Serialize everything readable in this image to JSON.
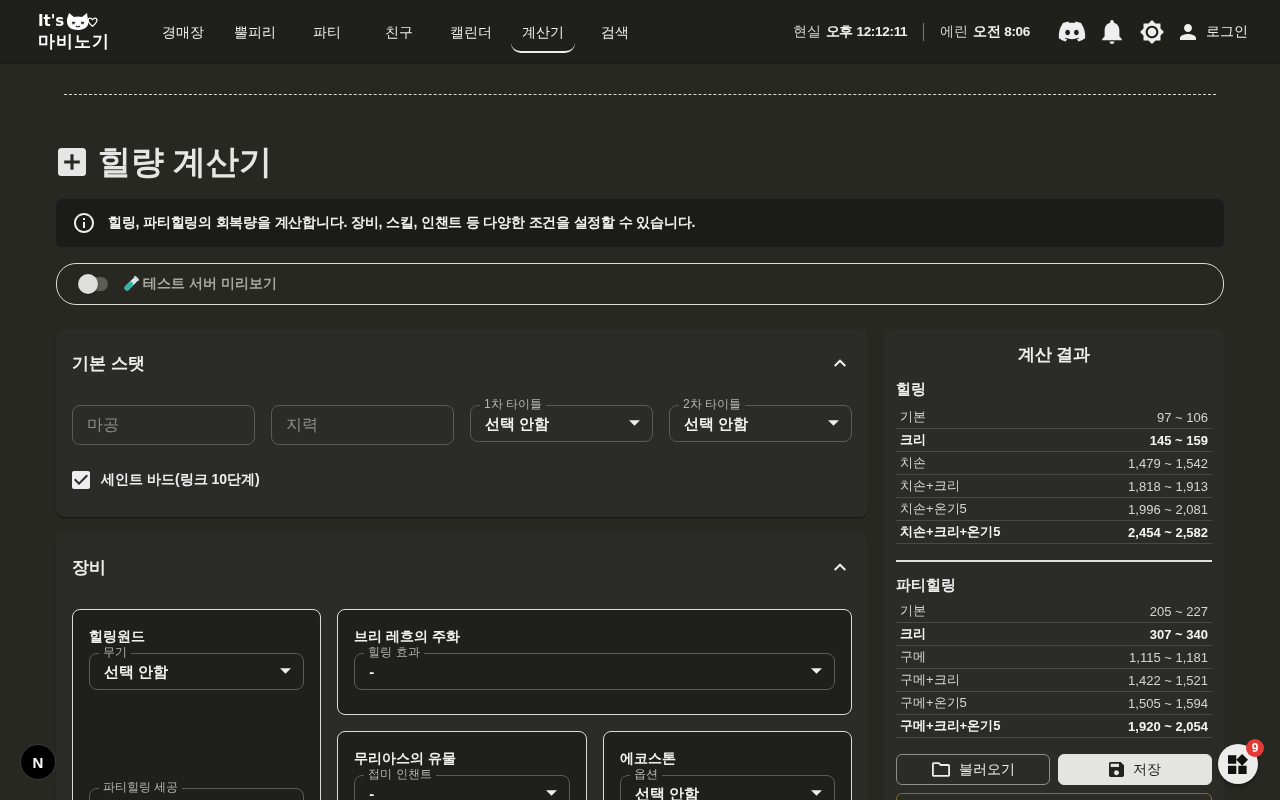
{
  "header": {
    "logo": {
      "line1": "It's",
      "line2": "마비노기"
    },
    "nav": [
      {
        "label": "경매장",
        "selected": false
      },
      {
        "label": "뿔피리",
        "selected": false
      },
      {
        "label": "파티",
        "selected": false
      },
      {
        "label": "친구",
        "selected": false
      },
      {
        "label": "캘린더",
        "selected": false
      },
      {
        "label": "계산기",
        "selected": true
      },
      {
        "label": "검색",
        "selected": false
      }
    ],
    "clocks": [
      {
        "label": "현실",
        "value": "오후 12:12:11"
      },
      {
        "label": "에린",
        "value": "오전 8:06"
      }
    ],
    "login": "로그인"
  },
  "page": {
    "title": "힐량 계산기",
    "notice": "힐링, 파티힐링의 회복량을 계산합니다. 장비, 스킬, 인챈트 등 다양한 조건을 설정할 수 있습니다.",
    "test_server": {
      "label": "테스트 서버 미리보기",
      "on": false
    }
  },
  "sections": [
    {
      "title": "기본 스탯",
      "expanded": true,
      "fields": [
        {
          "kind": "input",
          "placeholder": "마공"
        },
        {
          "kind": "input",
          "placeholder": "지력"
        },
        {
          "kind": "select",
          "label": "1차 타이틀",
          "value": "선택 안함"
        },
        {
          "kind": "select",
          "label": "2차 타이틀",
          "value": "선택 안함"
        }
      ],
      "checkboxes": [
        {
          "label": "세인트 바드(링크 10단계)",
          "checked": true
        }
      ]
    },
    {
      "title": "장비",
      "expanded": true,
      "cards": [
        {
          "title": "힐링원드",
          "fields": [
            {
              "label": "무기",
              "value": "선택 안함"
            },
            {
              "label": "파티힐링 세공"
            }
          ]
        },
        {
          "title": "브리 레흐의 주화",
          "fields": [
            {
              "label": "힐링 효과",
              "value": "-"
            }
          ]
        },
        {
          "title": "무리아스의 유물",
          "fields": [
            {
              "label": "접미 인챈트",
              "value": "-"
            }
          ]
        },
        {
          "title": "에코스톤",
          "fields": [
            {
              "label": "옵션",
              "value": "선택 안함"
            }
          ]
        }
      ]
    }
  ],
  "results": {
    "title": "계산 결과",
    "groups": [
      {
        "name": "힐링",
        "rows": [
          {
            "label": "기본",
            "value": "97 ~ 106",
            "emphasized": false
          },
          {
            "label": "크리",
            "value": "145 ~ 159",
            "emphasized": true
          },
          {
            "label": "치손",
            "value": "1,479 ~ 1,542",
            "emphasized": false
          },
          {
            "label": "치손+크리",
            "value": "1,818 ~ 1,913",
            "emphasized": false
          },
          {
            "label": "치손+온기5",
            "value": "1,996 ~ 2,081",
            "emphasized": false
          },
          {
            "label": "치손+크리+온기5",
            "value": "2,454 ~ 2,582",
            "emphasized": true
          }
        ]
      },
      {
        "name": "파티힐링",
        "rows": [
          {
            "label": "기본",
            "value": "205 ~ 227",
            "emphasized": false
          },
          {
            "label": "크리",
            "value": "307 ~ 340",
            "emphasized": true
          },
          {
            "label": "구메",
            "value": "1,115 ~ 1,181",
            "emphasized": false
          },
          {
            "label": "구메+크리",
            "value": "1,422 ~ 1,521",
            "emphasized": false
          },
          {
            "label": "구메+온기5",
            "value": "1,505 ~ 1,594",
            "emphasized": false
          },
          {
            "label": "구메+크리+온기5",
            "value": "1,920 ~ 2,054",
            "emphasized": true
          }
        ]
      }
    ],
    "buttons": [
      {
        "label": "불러오기",
        "kind": "load"
      },
      {
        "label": "저장",
        "kind": "save"
      }
    ]
  },
  "floating": {
    "dev_button": "N",
    "apps_badge": "9"
  }
}
